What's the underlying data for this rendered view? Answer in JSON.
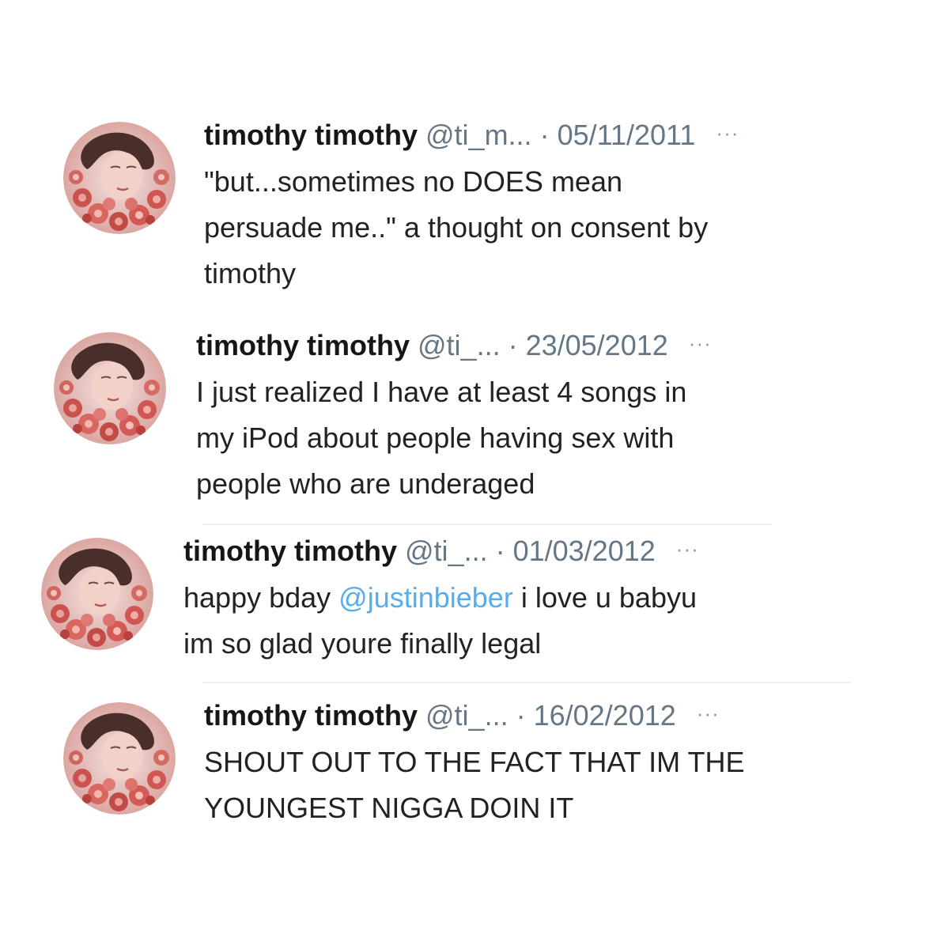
{
  "tweets": [
    {
      "name": "timothy timothy",
      "handle": "@ti_m...",
      "date": "· 05/11/2011",
      "more": "···",
      "text_lines": [
        "\"but...sometimes no DOES mean",
        "persuade me..\" a thought on consent by",
        "timothy"
      ]
    },
    {
      "name": "timothy timothy",
      "handle": "@ti_...",
      "date": "· 23/05/2012",
      "more": "···",
      "text_lines": [
        "I just realized I have at least 4 songs in",
        "my iPod about people having sex with",
        "people who are underaged"
      ]
    },
    {
      "name": "timothy timothy",
      "handle": "@ti_...",
      "date": "· 01/03/2012",
      "more": "···",
      "text_before_mention": "happy bday ",
      "mention": "@justinbieber",
      "text_after_mention": " i love u babyu",
      "text_line2": "im so glad youre finally legal"
    },
    {
      "name": "timothy timothy",
      "handle": "@ti_...",
      "date": "· 16/02/2012",
      "more": "···",
      "text_lines": [
        "SHOUT OUT TO THE FACT THAT IM THE",
        "YOUNGEST NIGGA DOIN IT"
      ]
    }
  ],
  "colors": {
    "name": "#14171a",
    "meta": "#657786",
    "mention": "#55acee",
    "text": "#222222"
  }
}
